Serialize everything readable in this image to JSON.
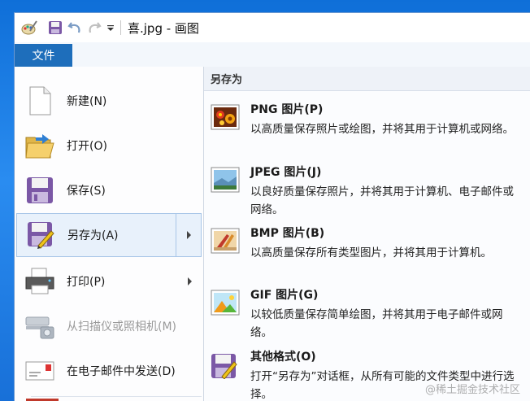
{
  "window": {
    "title": "喜.jpg - 画图",
    "qat_more_icon": "dropdown-arrow-icon"
  },
  "tabs": {
    "file": "文件"
  },
  "menu": {
    "items": [
      {
        "label": "新建(N)",
        "icon": "new-document-icon",
        "enabled": true,
        "submenu": false
      },
      {
        "label": "打开(O)",
        "icon": "open-folder-icon",
        "enabled": true,
        "submenu": false
      },
      {
        "label": "保存(S)",
        "icon": "save-icon",
        "enabled": true,
        "submenu": false
      },
      {
        "label": "另存为(A)",
        "icon": "save-as-icon",
        "enabled": true,
        "submenu": true,
        "selected": true
      },
      {
        "label": "打印(P)",
        "icon": "printer-icon",
        "enabled": true,
        "submenu": true
      },
      {
        "label": "从扫描仪或照相机(M)",
        "icon": "scanner-icon",
        "enabled": false,
        "submenu": false
      },
      {
        "label": "在电子邮件中发送(D)",
        "icon": "email-icon",
        "enabled": true,
        "submenu": false
      }
    ]
  },
  "saveas": {
    "header": "另存为",
    "options": [
      {
        "title": "PNG 图片(P)",
        "desc": "以高质量保存照片或绘图，并将其用于计算机或网络。",
        "icon": "png-image-icon"
      },
      {
        "title": "JPEG 图片(J)",
        "desc": "以良好质量保存照片，并将其用于计算机、电子邮件或网络。",
        "icon": "jpeg-image-icon"
      },
      {
        "title": "BMP 图片(B)",
        "desc": "以高质量保存所有类型图片，并将其用于计算机。",
        "icon": "bmp-image-icon"
      },
      {
        "title": "GIF 图片(G)",
        "desc": "以较低质量保存简单绘图，并将其用于电子邮件或网络。",
        "icon": "gif-image-icon"
      },
      {
        "title": "其他格式(O)",
        "desc": "打开“另存为”对话框，从所有可能的文件类型中进行选择。",
        "icon": "other-formats-icon"
      }
    ]
  },
  "watermark": "@稀土掘金技术社区"
}
